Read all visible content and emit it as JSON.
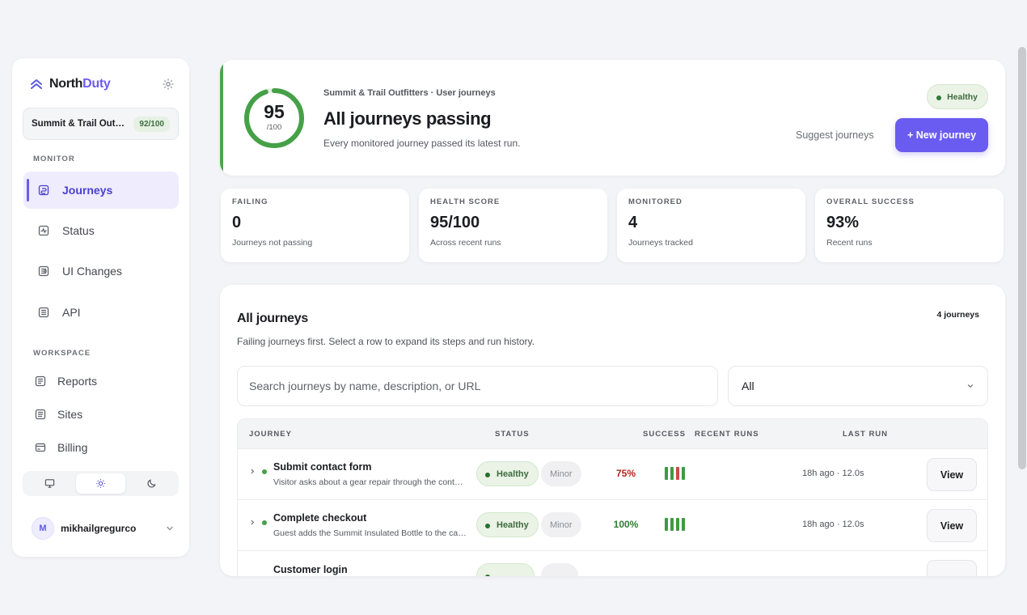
{
  "brand": {
    "name_part1": "North",
    "name_part2": "Duty"
  },
  "sidebar": {
    "site": {
      "name": "Summit & Trail Outfitters",
      "score": "92/100"
    },
    "monitor_label": "MONITOR",
    "workspace_label": "WORKSPACE",
    "monitor_items": [
      {
        "label": "Journeys",
        "icon": "journeys-icon",
        "active": true
      },
      {
        "label": "Status",
        "icon": "status-icon"
      },
      {
        "label": "UI Changes",
        "icon": "ui-changes-icon"
      },
      {
        "label": "API",
        "icon": "api-icon"
      }
    ],
    "workspace_items": [
      {
        "label": "Reports",
        "icon": "reports-icon"
      },
      {
        "label": "Sites",
        "icon": "sites-icon"
      },
      {
        "label": "Billing",
        "icon": "billing-icon"
      }
    ],
    "theme": {
      "selected": "light",
      "options": [
        "system",
        "light",
        "dark"
      ]
    },
    "user": {
      "initial": "M",
      "name": "mikhailgregurco"
    }
  },
  "hero": {
    "score": "95",
    "score_denominator": "/100",
    "score_fraction": 0.95,
    "crumb": "Summit & Trail Outfitters · User journeys",
    "title": "All journeys passing",
    "subtitle": "Every monitored journey passed its latest run.",
    "badge": "Healthy",
    "suggest_label": "Suggest journeys",
    "new_label": "+ New journey"
  },
  "stats": [
    {
      "label": "FAILING",
      "value": "0",
      "sub": "Journeys not passing"
    },
    {
      "label": "HEALTH SCORE",
      "value": "95/100",
      "sub": "Across recent runs"
    },
    {
      "label": "MONITORED",
      "value": "4",
      "sub": "Journeys tracked"
    },
    {
      "label": "OVERALL SUCCESS",
      "value": "93%",
      "sub": "Recent runs"
    }
  ],
  "journeys": {
    "title": "All journeys",
    "count": "4 journeys",
    "subtitle": "Failing journeys first. Select a row to expand its steps and run history.",
    "search_placeholder": "Search journeys by name, description, or URL",
    "filter_value": "All",
    "columns": {
      "journey": "JOURNEY",
      "status": "STATUS",
      "success": "SUCCESS",
      "recent_runs": "RECENT RUNS",
      "last_run": "LAST RUN"
    },
    "rows": [
      {
        "name": "Submit contact form",
        "description": "Visitor asks about a gear repair through the contact form",
        "status": "Healthy",
        "severity": "Minor",
        "success": "75%",
        "success_color": "#b3261e",
        "runs": [
          "pass",
          "pass",
          "fail",
          "pass"
        ],
        "last_run": "18h ago · 12.0s",
        "action": "View"
      },
      {
        "name": "Complete checkout",
        "description": "Guest adds the Summit Insulated Bottle to the cart and checks out",
        "status": "Healthy",
        "severity": "Minor",
        "success": "100%",
        "success_color": "#2e7d32",
        "runs": [
          "pass",
          "pass",
          "pass",
          "pass"
        ],
        "last_run": "18h ago · 12.0s",
        "action": "View"
      },
      {
        "name": "Customer login",
        "description": "",
        "status": "",
        "severity": "",
        "success": "",
        "success_color": "#2e7d32",
        "runs": [],
        "last_run": "",
        "action": ""
      }
    ]
  },
  "colors": {
    "accent": "#6a5cf0",
    "pass": "#3f9a42",
    "fail": "#c94a44",
    "healthy_bg": "#eaf3e6"
  }
}
